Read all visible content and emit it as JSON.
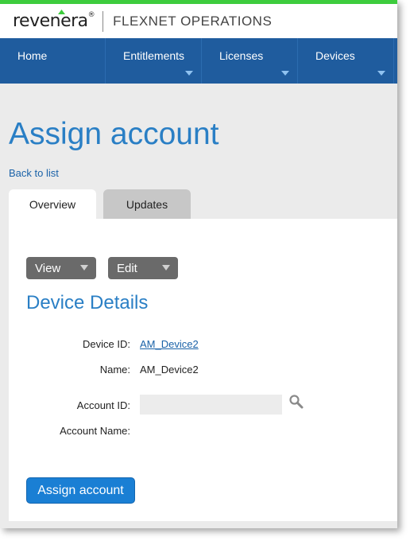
{
  "brand": {
    "logo_text": "revenera",
    "product_name": "FLEXNET OPERATIONS",
    "accent_color": "#3dcc3d"
  },
  "nav": {
    "items": [
      {
        "label": "Home",
        "has_dropdown": false
      },
      {
        "label": "Entitlements",
        "has_dropdown": true
      },
      {
        "label": "Licenses",
        "has_dropdown": true
      },
      {
        "label": "Devices",
        "has_dropdown": true
      }
    ],
    "background_color": "#1f5c9e"
  },
  "page": {
    "title": "Assign account",
    "back_link": "Back to list"
  },
  "tabs": [
    {
      "label": "Overview",
      "active": true
    },
    {
      "label": "Updates",
      "active": false
    }
  ],
  "toolbar": {
    "view_label": "View",
    "edit_label": "Edit"
  },
  "device_details": {
    "title": "Device Details",
    "device_id_label": "Device ID:",
    "device_id_value": "AM_Device2",
    "name_label": "Name:",
    "name_value": "AM_Device2",
    "account_id_label": "Account ID:",
    "account_id_value": "",
    "account_name_label": "Account Name:",
    "account_name_value": ""
  },
  "actions": {
    "assign_label": "Assign account"
  }
}
